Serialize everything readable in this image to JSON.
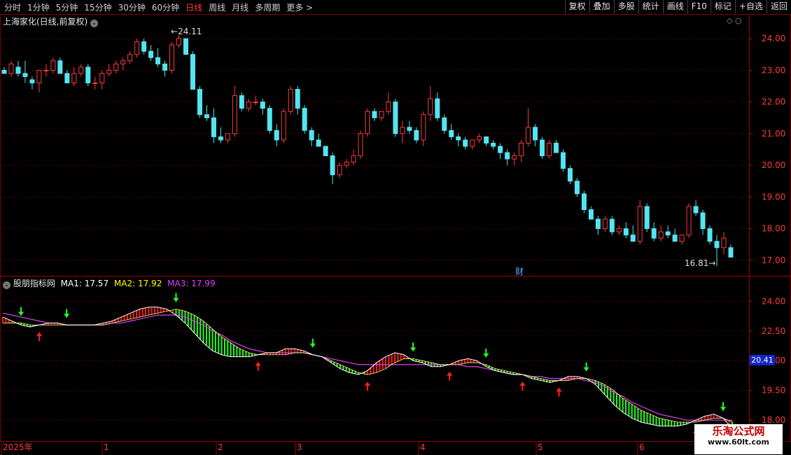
{
  "toolbar": {
    "periods": [
      "分时",
      "1分钟",
      "5分钟",
      "15分钟",
      "30分钟",
      "60分钟",
      "日线",
      "周线",
      "月线",
      "多周期",
      "更多 >"
    ],
    "active_period": "日线",
    "buttons": [
      "复权",
      "叠加",
      "多股",
      "统计",
      "画线",
      "F10",
      "标记",
      "+自选",
      "返回"
    ]
  },
  "main_panel": {
    "title": "上海家化(日线,前复权)",
    "high_marker": "24.11",
    "low_marker": "16.81",
    "fin_marker": "财",
    "y_ticks": [
      "24.00",
      "23.00",
      "22.00",
      "21.00",
      "20.00",
      "19.00",
      "18.00",
      "17.00"
    ]
  },
  "indicator_panel": {
    "name": "股朋指标网",
    "ma1_label": "MA1: 17.57",
    "ma2_label": "MA2: 17.92",
    "ma3_label": "MA3: 17.99",
    "y_ticks": [
      "24.00",
      "22.50",
      "21.00",
      "19.50",
      "18.00"
    ],
    "price_tag": "20.41"
  },
  "x_axis": {
    "labels": [
      "2025年",
      "1",
      "2",
      "3",
      "4",
      "5",
      "6"
    ]
  },
  "watermark": {
    "line1": "乐淘公式网",
    "line2": "www.60lt.com"
  },
  "colors": {
    "up": "#ff3b3b",
    "down": "#54e5f2",
    "bg": "#000000",
    "grid": "#5a0000",
    "ma_fast": "#ffffff",
    "ma_slow": "#e040fb",
    "fill_up": "#ff1a1a",
    "fill_down": "#22ff22"
  },
  "chart_data": [
    {
      "type": "candlestick",
      "title": "上海家化(日线,前复权)",
      "ylim": [
        16.6,
        24.6
      ],
      "max_label": 24.11,
      "min_label": 16.81,
      "ohlc": [
        [
          23.0,
          23.1,
          22.9,
          22.9
        ],
        [
          22.9,
          23.3,
          22.8,
          23.2
        ],
        [
          23.1,
          23.3,
          22.8,
          22.9
        ],
        [
          22.9,
          23.3,
          22.6,
          22.8
        ],
        [
          22.7,
          22.8,
          22.4,
          22.6
        ],
        [
          22.6,
          23.0,
          22.3,
          23.0
        ],
        [
          23.0,
          23.2,
          22.8,
          23.0
        ],
        [
          23.0,
          23.4,
          22.9,
          23.3
        ],
        [
          23.3,
          23.4,
          22.9,
          22.9
        ],
        [
          22.9,
          23.0,
          22.6,
          22.6
        ],
        [
          22.6,
          23.1,
          22.5,
          22.9
        ],
        [
          22.9,
          23.2,
          22.8,
          23.1
        ],
        [
          23.1,
          23.2,
          22.5,
          22.6
        ],
        [
          22.6,
          22.8,
          22.4,
          22.6
        ],
        [
          22.6,
          23.0,
          22.4,
          22.9
        ],
        [
          22.9,
          23.2,
          22.8,
          23.0
        ],
        [
          23.0,
          23.3,
          22.9,
          23.2
        ],
        [
          23.2,
          23.4,
          23.0,
          23.3
        ],
        [
          23.3,
          23.6,
          23.2,
          23.5
        ],
        [
          23.5,
          24.0,
          23.4,
          23.9
        ],
        [
          23.9,
          24.0,
          23.5,
          23.6
        ],
        [
          23.6,
          23.8,
          23.3,
          23.4
        ],
        [
          23.4,
          23.7,
          23.1,
          23.2
        ],
        [
          23.2,
          23.3,
          22.8,
          23.0
        ],
        [
          23.0,
          23.9,
          22.9,
          23.8
        ],
        [
          23.8,
          24.11,
          23.7,
          24.0
        ],
        [
          24.0,
          24.0,
          23.5,
          23.5
        ],
        [
          23.5,
          23.6,
          22.4,
          22.4
        ],
        [
          22.4,
          22.5,
          21.5,
          21.6
        ],
        [
          21.6,
          21.9,
          21.4,
          21.5
        ],
        [
          21.5,
          21.8,
          20.7,
          20.9
        ],
        [
          20.9,
          21.2,
          20.7,
          20.8
        ],
        [
          20.8,
          21.0,
          20.7,
          21.0
        ],
        [
          21.0,
          22.5,
          20.9,
          22.2
        ],
        [
          22.2,
          22.3,
          21.7,
          21.8
        ],
        [
          21.8,
          22.1,
          21.7,
          22.0
        ],
        [
          22.0,
          22.2,
          21.9,
          22.0
        ],
        [
          22.0,
          22.1,
          21.6,
          21.8
        ],
        [
          21.8,
          21.9,
          21.0,
          21.1
        ],
        [
          21.1,
          21.3,
          20.6,
          20.8
        ],
        [
          20.8,
          21.8,
          20.7,
          21.7
        ],
        [
          21.7,
          22.5,
          21.6,
          22.4
        ],
        [
          22.4,
          22.5,
          21.6,
          21.8
        ],
        [
          21.8,
          21.9,
          21.0,
          21.1
        ],
        [
          21.1,
          21.2,
          20.6,
          20.8
        ],
        [
          20.8,
          21.0,
          20.6,
          20.6
        ],
        [
          20.6,
          20.6,
          20.3,
          20.3
        ],
        [
          20.3,
          20.4,
          19.4,
          19.7
        ],
        [
          19.7,
          20.1,
          19.6,
          20.0
        ],
        [
          20.0,
          20.2,
          19.9,
          20.1
        ],
        [
          20.1,
          20.5,
          20.0,
          20.3
        ],
        [
          20.3,
          21.1,
          20.2,
          21.0
        ],
        [
          21.0,
          21.8,
          20.9,
          21.7
        ],
        [
          21.7,
          21.8,
          21.4,
          21.5
        ],
        [
          21.5,
          21.7,
          21.4,
          21.7
        ],
        [
          21.7,
          22.3,
          21.6,
          22.0
        ],
        [
          22.0,
          22.1,
          20.9,
          21.0
        ],
        [
          21.0,
          21.4,
          20.7,
          21.2
        ],
        [
          21.2,
          21.4,
          21.0,
          21.1
        ],
        [
          21.1,
          21.2,
          20.7,
          20.8
        ],
        [
          20.8,
          21.7,
          20.6,
          21.6
        ],
        [
          21.6,
          22.5,
          21.4,
          22.1
        ],
        [
          22.1,
          22.3,
          21.4,
          21.5
        ],
        [
          21.5,
          21.6,
          21.0,
          21.1
        ],
        [
          21.1,
          21.3,
          20.8,
          20.9
        ],
        [
          20.9,
          21.0,
          20.6,
          20.8
        ],
        [
          20.8,
          20.9,
          20.5,
          20.6
        ],
        [
          20.6,
          20.8,
          20.5,
          20.8
        ],
        [
          20.8,
          21.0,
          20.7,
          20.9
        ],
        [
          20.9,
          20.9,
          20.6,
          20.7
        ],
        [
          20.7,
          20.8,
          20.5,
          20.6
        ],
        [
          20.6,
          20.7,
          20.2,
          20.4
        ],
        [
          20.4,
          20.5,
          20.0,
          20.2
        ],
        [
          20.2,
          20.4,
          20.0,
          20.3
        ],
        [
          20.3,
          20.8,
          20.1,
          20.7
        ],
        [
          20.7,
          21.8,
          20.6,
          21.2
        ],
        [
          21.2,
          21.3,
          20.6,
          20.8
        ],
        [
          20.8,
          20.9,
          20.2,
          20.3
        ],
        [
          20.3,
          20.8,
          20.2,
          20.7
        ],
        [
          20.7,
          20.8,
          20.4,
          20.4
        ],
        [
          20.4,
          20.5,
          19.8,
          19.9
        ],
        [
          19.9,
          20.0,
          19.4,
          19.5
        ],
        [
          19.5,
          19.6,
          19.0,
          19.1
        ],
        [
          19.1,
          19.2,
          18.5,
          18.6
        ],
        [
          18.6,
          18.7,
          18.3,
          18.3
        ],
        [
          18.3,
          18.4,
          17.8,
          18.0
        ],
        [
          18.0,
          18.4,
          17.9,
          18.3
        ],
        [
          18.3,
          18.4,
          17.8,
          17.9
        ],
        [
          17.9,
          18.1,
          17.8,
          18.0
        ],
        [
          18.0,
          18.2,
          17.7,
          17.8
        ],
        [
          17.8,
          18.1,
          17.6,
          17.6
        ],
        [
          17.6,
          18.9,
          17.5,
          18.7
        ],
        [
          18.7,
          18.8,
          17.9,
          18.0
        ],
        [
          18.0,
          18.2,
          17.6,
          17.7
        ],
        [
          17.7,
          18.1,
          17.6,
          17.9
        ],
        [
          17.9,
          18.1,
          17.7,
          17.8
        ],
        [
          17.8,
          18.0,
          17.6,
          17.6
        ],
        [
          17.6,
          17.8,
          17.5,
          17.8
        ],
        [
          17.8,
          18.8,
          17.7,
          18.7
        ],
        [
          18.7,
          18.9,
          18.4,
          18.5
        ],
        [
          18.5,
          18.6,
          17.8,
          18.0
        ],
        [
          18.0,
          18.1,
          17.5,
          17.6
        ],
        [
          17.6,
          17.8,
          16.81,
          17.4
        ],
        [
          17.4,
          17.9,
          17.2,
          17.7
        ],
        [
          17.4,
          17.5,
          17.1,
          17.1
        ]
      ]
    },
    {
      "type": "line",
      "title": "股朋指标网",
      "ylim": [
        17.3,
        25.0
      ],
      "series": [
        {
          "name": "MA1",
          "values": [
            23.2,
            23.0,
            22.8,
            22.7,
            22.8,
            22.9,
            22.9,
            22.8,
            22.8,
            22.8,
            22.8,
            22.9,
            23.0,
            23.2,
            23.4,
            23.6,
            23.7,
            23.7,
            23.6,
            23.3,
            22.9,
            22.4,
            21.9,
            21.5,
            21.3,
            21.2,
            21.2,
            21.2,
            21.3,
            21.4,
            21.4,
            21.6,
            21.6,
            21.5,
            21.3,
            21.2,
            20.9,
            20.6,
            20.4,
            20.3,
            20.5,
            20.9,
            21.2,
            21.4,
            21.3,
            21.0,
            20.9,
            20.7,
            20.7,
            20.8,
            21.0,
            21.1,
            21.0,
            20.7,
            20.5,
            20.4,
            20.3,
            20.3,
            20.1,
            20.0,
            19.9,
            20.0,
            20.2,
            20.2,
            20.1,
            19.8,
            19.3,
            18.8,
            18.4,
            18.1,
            17.9,
            17.8,
            17.7,
            17.7,
            17.7,
            17.8,
            18.0,
            18.2,
            18.3,
            18.1,
            17.57
          ]
        },
        {
          "name": "MA2",
          "values": [
            22.9,
            22.9,
            22.9,
            22.8,
            22.8,
            22.8,
            22.8,
            22.8,
            22.8,
            22.8,
            22.8,
            22.8,
            22.9,
            23.0,
            23.1,
            23.2,
            23.3,
            23.4,
            23.5,
            23.6,
            23.5,
            23.3,
            23.0,
            22.6,
            22.2,
            21.9,
            21.6,
            21.4,
            21.3,
            21.3,
            21.3,
            21.3,
            21.4,
            21.4,
            21.3,
            21.2,
            21.0,
            20.8,
            20.6,
            20.4,
            20.3,
            20.4,
            20.6,
            20.9,
            21.1,
            21.1,
            21.0,
            20.9,
            20.8,
            20.8,
            20.8,
            20.9,
            20.9,
            20.8,
            20.6,
            20.5,
            20.4,
            20.3,
            20.2,
            20.1,
            20.0,
            20.0,
            20.0,
            20.1,
            20.1,
            20.0,
            19.8,
            19.5,
            19.1,
            18.8,
            18.5,
            18.3,
            18.1,
            18.0,
            17.9,
            17.9,
            17.9,
            18.0,
            18.1,
            18.1,
            17.92
          ]
        },
        {
          "name": "MA3",
          "values": [
            23.4,
            23.3,
            23.2,
            23.1,
            23.0,
            22.9,
            22.9,
            22.8,
            22.8,
            22.8,
            22.8,
            22.8,
            22.9,
            22.9,
            23.0,
            23.1,
            23.2,
            23.3,
            23.3,
            23.3,
            23.2,
            23.0,
            22.8,
            22.5,
            22.3,
            22.0,
            21.8,
            21.6,
            21.5,
            21.4,
            21.4,
            21.4,
            21.4,
            21.4,
            21.3,
            21.2,
            21.1,
            21.0,
            20.9,
            20.8,
            20.8,
            20.8,
            20.8,
            20.8,
            20.8,
            20.8,
            20.8,
            20.8,
            20.8,
            20.8,
            20.8,
            20.7,
            20.7,
            20.6,
            20.5,
            20.4,
            20.3,
            20.3,
            20.2,
            20.2,
            20.1,
            20.1,
            20.1,
            20.1,
            20.0,
            19.9,
            19.7,
            19.4,
            19.2,
            18.9,
            18.7,
            18.5,
            18.3,
            18.2,
            18.1,
            18.0,
            18.0,
            18.0,
            18.0,
            18.0,
            17.99
          ]
        }
      ]
    }
  ]
}
